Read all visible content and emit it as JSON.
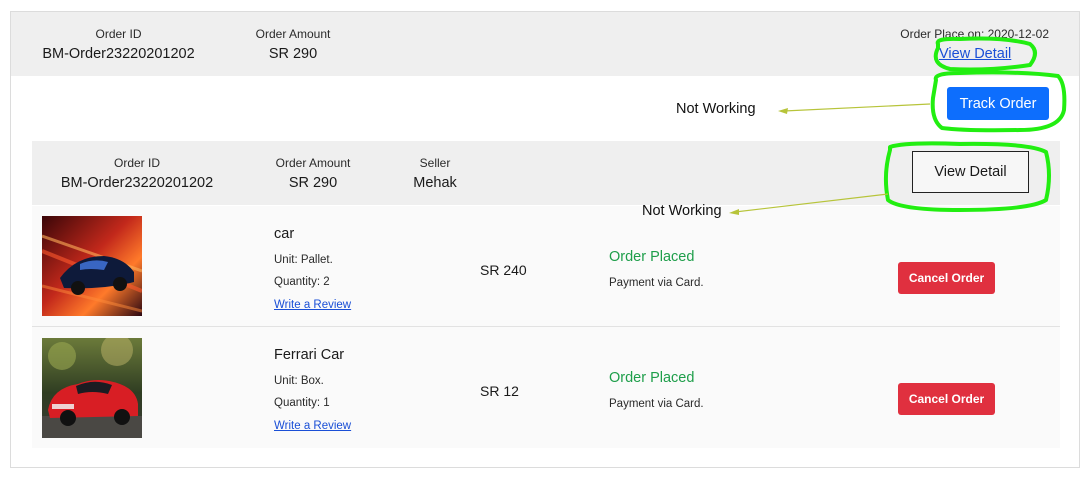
{
  "top": {
    "order_id_label": "Order ID",
    "order_id": "BM-Order23220201202",
    "amount_label": "Order Amount",
    "amount": "SR 290",
    "order_place": "Order Place on: 2020-12-02",
    "view_detail": "View Detail",
    "track_order": "Track Order"
  },
  "sub": {
    "order_id_label": "Order ID",
    "order_id": "BM-Order23220201202",
    "amount_label": "Order Amount",
    "amount": "SR 290",
    "seller_label": "Seller",
    "seller": "Mehak",
    "view_detail": "View Detail"
  },
  "annotations": {
    "note_1": "Not Working",
    "note_2": "Not Working",
    "highlight_color": "#22ee11",
    "arrow_color": "#b7c43a"
  },
  "items": [
    {
      "name": "car",
      "unit": "Unit: Pallet.",
      "quantity": "Quantity: 2",
      "review": "Write a Review",
      "price": "SR 240",
      "status": "Order Placed",
      "payment": "Payment via Card.",
      "cancel": "Cancel Order",
      "image": "sports-car-neon-image"
    },
    {
      "name": "Ferrari Car",
      "unit": "Unit: Box.",
      "quantity": "Quantity: 1",
      "review": "Write a Review",
      "price": "SR 12",
      "status": "Order Placed",
      "payment": "Payment via Card.",
      "cancel": "Cancel Order",
      "image": "red-mustang-image"
    }
  ]
}
